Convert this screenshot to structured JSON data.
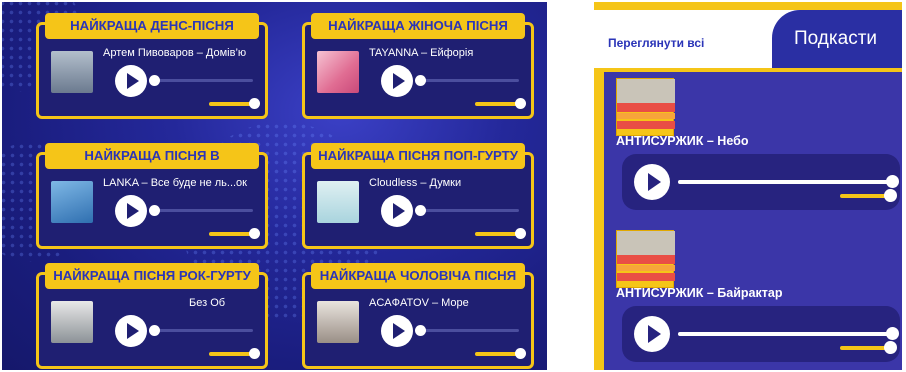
{
  "awards": {
    "cards": [
      {
        "title": "НАЙКРАЩА ДЕНС-ПІСНЯ",
        "track": "Артем Пивоваров – Домів’ю",
        "cover_color": "#7c8a9e"
      },
      {
        "title": "НАЙКРАЩА ЖІНОЧА ПІСНЯ",
        "track": "TAYANNA – Ейфорія",
        "cover_color": "#e89ab0"
      },
      {
        "title": "НАЙКРАЩА ПІСНЯ В",
        "track": "LANKA – Все буде не ль...ок",
        "cover_color": "#4a8fc9"
      },
      {
        "title": "НАЙКРАЩА ПІСНЯ ПОП-ГУРТУ",
        "track": "Cloudless – Думки",
        "cover_color": "#b8d8e0"
      },
      {
        "title": "НАЙКРАЩА ПІСНЯ РОК-ГУРТУ",
        "track": "Без Об",
        "cover_color": "#9fa4a8"
      },
      {
        "title": "НАЙКРАЩА ЧОЛОВІЧА ПІСНЯ",
        "track": "ACAФATOV – Море",
        "cover_color": "#c7c0b8"
      }
    ]
  },
  "podcasts": {
    "view_all": "Переглянути всі",
    "title": "Подкасти",
    "items": [
      {
        "name": "АНТИСУРЖИК – Небо"
      },
      {
        "name": "АНТИСУРЖИК – Байрактар"
      }
    ]
  },
  "colors": {
    "accent_yellow": "#f5c518",
    "brand_blue": "#2b35b8",
    "panel_dark": "#1f1f72"
  }
}
